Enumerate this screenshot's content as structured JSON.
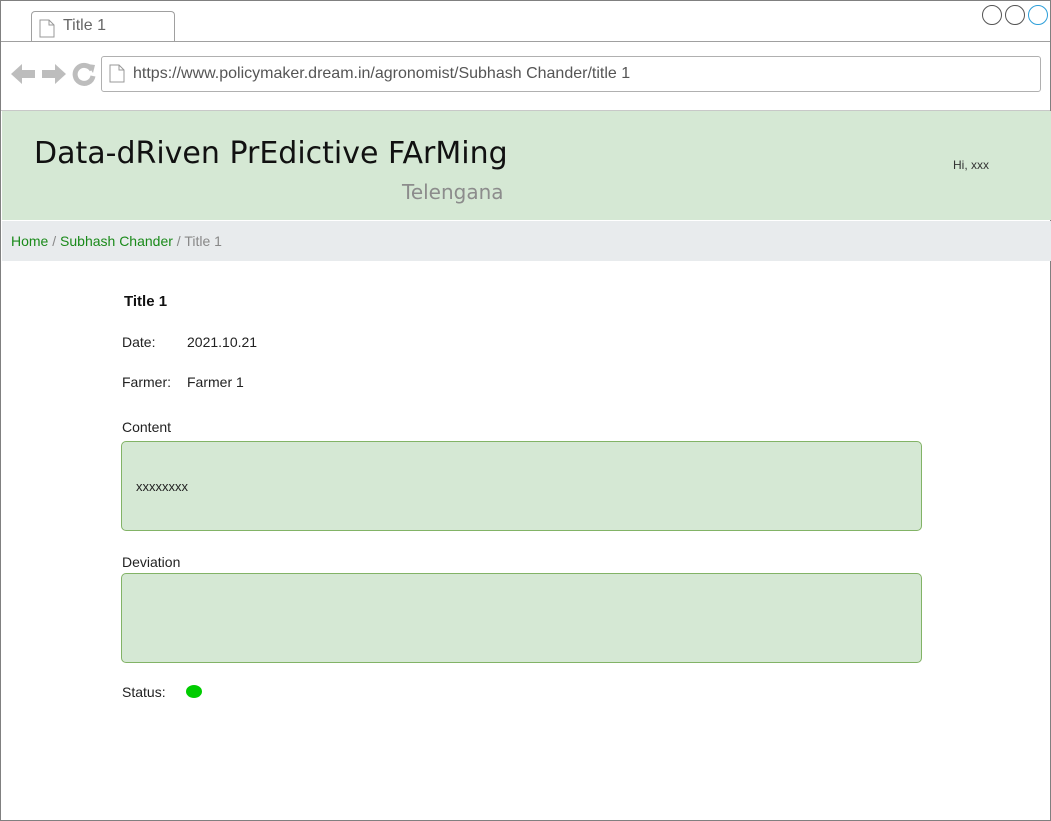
{
  "browser": {
    "tab_title": "Title 1",
    "url": "https://www.policymaker.dream.in/agronomist/Subhash Chander/title 1"
  },
  "header": {
    "title": "Data-dRiven PrEdictive FArMing",
    "subtitle": "Telengana",
    "greeting": "Hi, xxx"
  },
  "breadcrumb": {
    "home": "Home",
    "separator": "/",
    "parent": "Subhash Chander",
    "current": "Title 1"
  },
  "details": {
    "title": "Title 1",
    "date_label": "Date:",
    "date_value": "2021.10.21",
    "farmer_label": "Farmer:",
    "farmer_value": "Farmer 1",
    "content_label": "Content",
    "content_value": "xxxxxxxx",
    "deviation_label": "Deviation",
    "deviation_value": "",
    "status_label": "Status:",
    "status_color": "#00cc00"
  },
  "colors": {
    "header_bg": "#d5e8d4",
    "box_border": "#82b366",
    "link": "#1a8a1a",
    "breadcrumb_bg": "#e8ebed"
  }
}
